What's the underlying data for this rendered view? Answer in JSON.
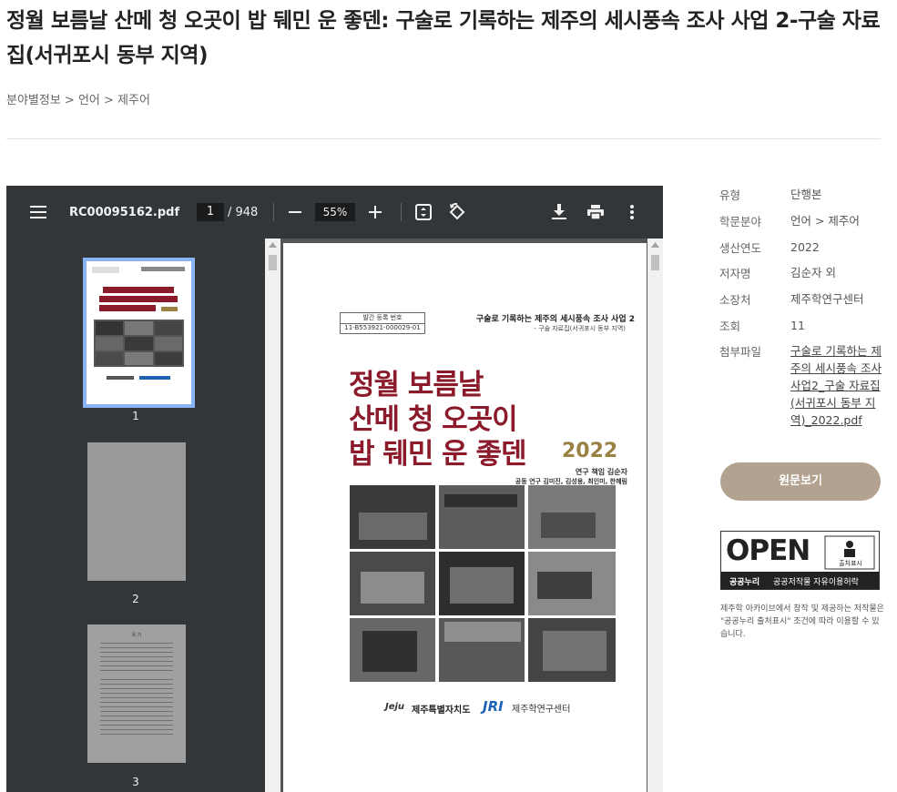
{
  "page": {
    "title": "정월 보름날 산메 청 오곳이 밥 뒈민 운 좋덴: 구술로 기록하는 제주의 세시풍속 조사 사업 2-구술 자료집(서귀포시 동부 지역)",
    "breadcrumb": "분야별정보 > 언어 > 제주어"
  },
  "viewer": {
    "filename": "RC00095162.pdf",
    "current_page": "1",
    "total_pages": "/ 948",
    "zoom": "55%",
    "thumbnails": [
      {
        "number": "1",
        "selected": true
      },
      {
        "number": "2",
        "selected": false
      },
      {
        "number": "3",
        "selected": false
      }
    ],
    "thumb3_heading": "목 차"
  },
  "cover": {
    "reg_label": "발간 등록 번호",
    "reg_number": "11-B553921-000029-01",
    "series": "구술로 기록하는 제주의 세시풍속 조사 사업 2",
    "series_sub": "- 구술 자료집(서귀포시 동부 지역)",
    "title_lines": [
      "정월 보름날",
      "산메 청 오곳이",
      "밥 뒈민 운 좋덴"
    ],
    "year": "2022",
    "credit_lead": "연구 책임  김순자",
    "credit_co": "공동 연구  김미진, 김성용, 최인미, 한혜림",
    "org1_mark": "Jeju",
    "org1": "제주특별자치도",
    "org2_mark": "JRI",
    "org2": "제주학연구센터"
  },
  "meta": [
    {
      "label": "유형",
      "value": "단행본"
    },
    {
      "label": "학문분야",
      "value": "언어 > 제주어"
    },
    {
      "label": "생산연도",
      "value": "2022"
    },
    {
      "label": "저자명",
      "value": "김순자 외"
    },
    {
      "label": "소장처",
      "value": "제주학연구센터"
    },
    {
      "label": "조회",
      "value": "11"
    },
    {
      "label": "첨부파일",
      "value": "구술로 기록하는 제주의 세시풍속 조사 사업2_구술 자료집(서귀포시 동부 지역)_2022.pdf"
    }
  ],
  "actions": {
    "view_original": "원문보기"
  },
  "license": {
    "open_text": "OPEN",
    "attribution_label": "출처표시",
    "kogl": "공공누리",
    "kogl_desc": "공공저작물 자유이용허락",
    "note": "제주학 아카이브에서 창작 및 제공하는 저작물은 \"공공누리 출처표시\" 조건에 따라 이용할 수 있습니다."
  },
  "colors": {
    "toolbar": "#323639",
    "viewer_bg": "#525659",
    "cover_title": "#8b1a2b",
    "year": "#9a8245",
    "button": "#b3a28f",
    "thumb_selected": "#8ab4f8"
  }
}
